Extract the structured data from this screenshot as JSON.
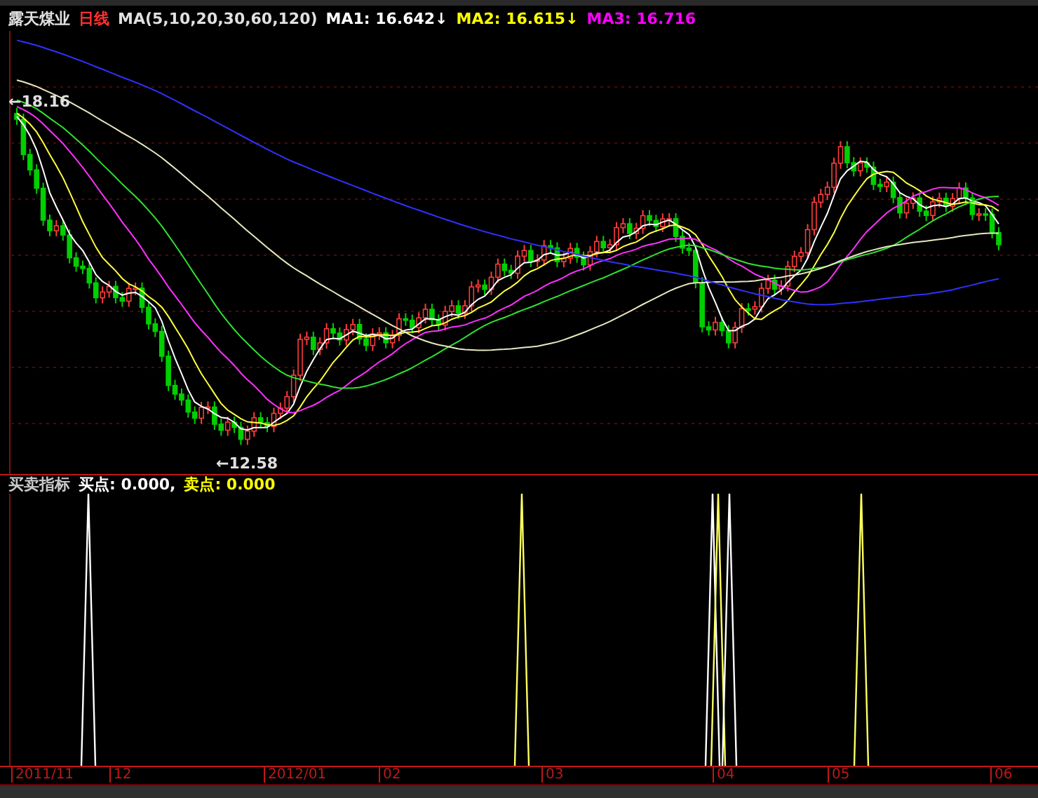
{
  "stock": {
    "name": "露天煤业",
    "period": "日线"
  },
  "ma_legend": {
    "label": "MA(5,10,20,30,60,120)",
    "items": [
      {
        "name": "MA1:",
        "value": "16.642",
        "arrow": "↓",
        "color": "#ffffff"
      },
      {
        "name": "MA2:",
        "value": "16.615",
        "arrow": "↓",
        "color": "#ffff00"
      },
      {
        "name": "MA3:",
        "value": "16.716",
        "color": "#ff00ff"
      }
    ]
  },
  "price_chart": {
    "high_label": "←18.16",
    "low_label": "←12.58"
  },
  "indicator": {
    "title": "买卖指标",
    "items": [
      {
        "name": "买点:",
        "value": "0.000,",
        "color": "#ffffff"
      },
      {
        "name": "卖点:",
        "value": "0.000",
        "color": "#ffff00"
      }
    ]
  },
  "date_axis": [
    "2011/11",
    "12",
    "2012/01",
    "02",
    "03",
    "04",
    "05",
    "06"
  ]
}
